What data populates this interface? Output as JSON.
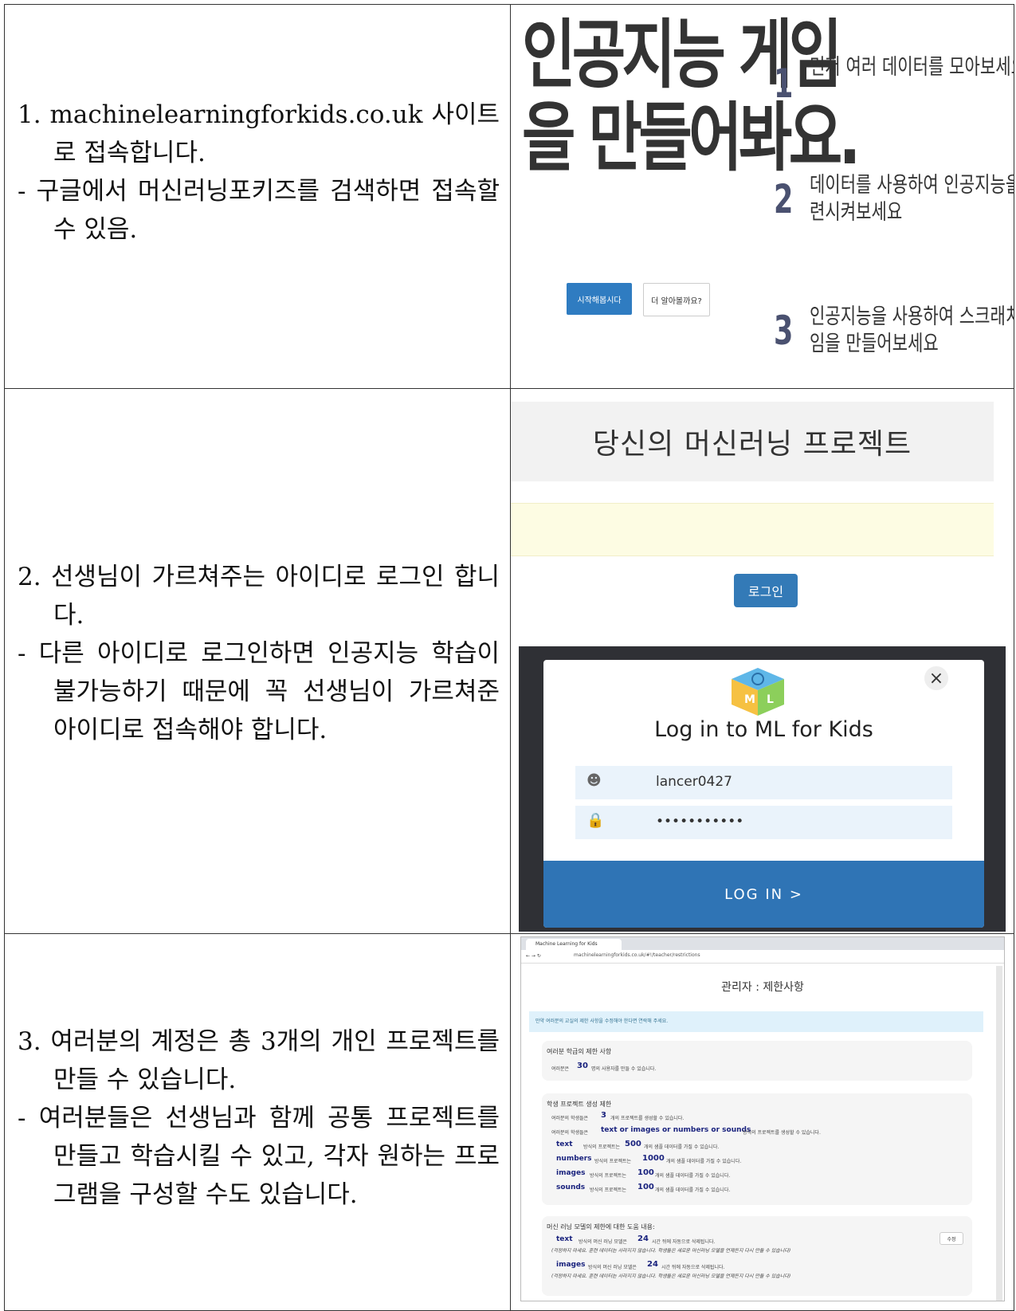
{
  "row1": {
    "text": {
      "line1": "1. machinelearningforkids.co.uk 사이트 로 접속합니다.",
      "line2": "- 구글에서 머신러닝포키즈를 검색하면 접속할 수 있음."
    },
    "image": {
      "title_line1": "인공지능 게임",
      "title_line2": "을 만들어봐요.",
      "steps": [
        {
          "num": "1",
          "text": "먼저 여러 데이터를 모아보세요",
          "text2": ""
        },
        {
          "num": "2",
          "text": "데이터를 사용하여 인공지능을 훈",
          "text2": "련시켜보세요"
        },
        {
          "num": "3",
          "text": "인공지능을 사용하여 스크래치 게",
          "text2": "임을 만들어보세요"
        }
      ],
      "start_button": "시작해봅시다",
      "more_button": "더 알아볼까요?"
    }
  },
  "row2": {
    "text": {
      "line1": "2. 선생님이 가르쳐주는 아이디로 로그인 합니다.",
      "line2": "- 다른 아이디로 로그인하면 인공지능 학습이 불가능하기 때문에 꼭 선생님이 가르쳐준 아이디로 접속해야 합니다."
    },
    "image": {
      "projects_header": "당신의 머신러닝 프로젝트",
      "login_button": "로그인",
      "modal": {
        "logo_text": "M L",
        "title": "Log in to ML for Kids",
        "username": "lancer0427",
        "password": "•••••••••••",
        "submit": "LOG IN >",
        "close": "×"
      }
    }
  },
  "row3": {
    "text": {
      "line1": "3. 여러분의 계정은 총 3개의 개인 프로젝트를 만들 수 있습니다.",
      "line2": "- 여러분들은 선생님과 함께 공통 프로젝트를 만들고 학습시킬 수 있고, 각자 원하는 프로그램을 구성할 수도 있습니다."
    },
    "image": {
      "tab_title": "Machine Learning for Kids",
      "url": "machinelearningforkids.co.uk/#!/teacher/restrictions",
      "page_title": "관리자 : 제한사항",
      "info": "만약 여러분의 교실의 제한 사항을 수정해야 한다면 연락해 주세요.",
      "class_panel_title": "여러분 학급의 제한 사항",
      "class_users_pre": "여러분은",
      "class_users_num": "30",
      "class_users_post": "명의 사용자를 만들 수 있습니다.",
      "student_panel_title": "학생 프로젝트 생성 제한",
      "student_projects_pre": "여러분의 학생들은",
      "student_projects_num": "3",
      "student_projects_post": "개의 프로젝트를 생성할 수 있습니다.",
      "types_pre": "여러분의 학생들은",
      "types_kw": "text or images or numbers or sounds",
      "types_post": "방식의 프로젝트를 생성할 수 있습니다.",
      "limits": [
        {
          "kw": "text",
          "mid": "방식의 프로젝트는",
          "num": "500",
          "post": "개의 샘플 데이터를 가질 수 있습니다."
        },
        {
          "kw": "numbers",
          "mid": "방식의 프로젝트는",
          "num": "1000",
          "post": "개의 샘플 데이터를 가질 수 있습니다."
        },
        {
          "kw": "images",
          "mid": "방식의 프로젝트는",
          "num": "100",
          "post": "개의 샘플 데이터를 가질 수 있습니다."
        },
        {
          "kw": "sounds",
          "mid": "방식의 프로젝트는",
          "num": "100",
          "post": "개의 샘플 데이터를 가질 수 있습니다."
        }
      ],
      "model_panel_title": "머신 러닝 모델의 제한에 대한 도움 내용:",
      "edit_button": "수정",
      "models": [
        {
          "kw": "text",
          "mid": "방식의 머신 러닝 모델은",
          "num": "24",
          "post": "시간 뒤에 자동으로 삭제됩니다.",
          "note": "(걱정하지 마세요. 훈련 데이터는 사라지지 않습니다. 학생들은 새로운 머신러닝 모델을 언제든지 다시 만들 수 있습니다)"
        },
        {
          "kw": "images",
          "mid": "방식의 머신 러닝 모델은",
          "num": "24",
          "post": "시간 뒤에 자동으로 삭제됩니다.",
          "note": "(걱정하지 마세요. 훈련 데이터는 사라지지 않습니다. 학생들은 새로운 머신러닝 모델을 언제든지 다시 만들 수 있습니다)"
        }
      ]
    }
  }
}
